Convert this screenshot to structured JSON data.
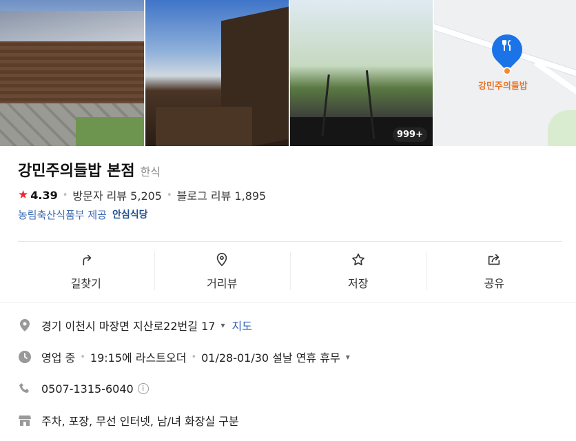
{
  "photos": {
    "count_badge": "999+"
  },
  "map": {
    "label": "강민주의들밥"
  },
  "place": {
    "name": "강민주의들밥 본점",
    "category": "한식",
    "rating": "4.39",
    "visitor_reviews": "방문자 리뷰 5,205",
    "blog_reviews": "블로그 리뷰 1,895",
    "provider": "농림축산식품부 제공",
    "safe_label": "안심식당"
  },
  "actions": [
    {
      "label": "길찾기",
      "icon": "directions-icon"
    },
    {
      "label": "거리뷰",
      "icon": "street-view-icon"
    },
    {
      "label": "저장",
      "icon": "star-icon"
    },
    {
      "label": "공유",
      "icon": "share-icon"
    }
  ],
  "details": {
    "address": "경기 이천시 마장면 지산로22번길 17",
    "map_link": "지도",
    "status": "영업 중",
    "last_order": "19:15에 라스트오더",
    "holiday": "01/28-01/30 설날 연휴 휴무",
    "phone": "0507-1315-6040",
    "amenities": "주차, 포장, 무선 인터넷, 남/녀 화장실 구분"
  },
  "colors": {
    "accent": "#2f62b8",
    "star": "#f0282d",
    "pin": "#1b73e8"
  }
}
